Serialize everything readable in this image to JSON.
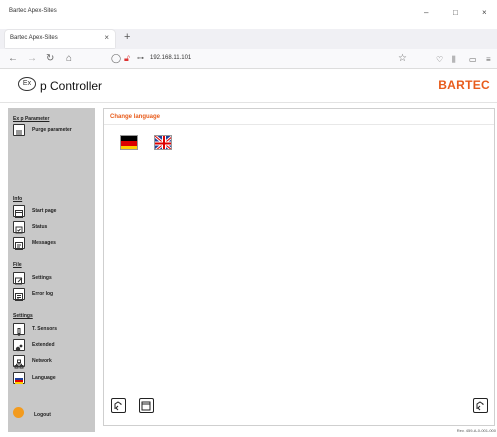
{
  "window": {
    "title": "Bartec Apex-Sites",
    "minimize": "–",
    "maximize": "□",
    "close": "×"
  },
  "tab": {
    "label": "Bartec Apex-Sites",
    "close": "×",
    "new_tab": "+"
  },
  "navbar": {
    "url": "192.168.11.101"
  },
  "header": {
    "logo_text": "Ex",
    "app_name": "p Controller",
    "brand": "BARTEC"
  },
  "sidebar": {
    "sections": [
      {
        "title": "Ex p Parameter",
        "items": [
          {
            "label": "Purge parameter",
            "icon": "purge-icon"
          }
        ]
      },
      {
        "title": "Info",
        "items": [
          {
            "label": "Start page",
            "icon": "start-page-icon"
          },
          {
            "label": "Status",
            "icon": "status-icon"
          },
          {
            "label": "Messages",
            "icon": "messages-icon"
          }
        ]
      },
      {
        "title": "File",
        "items": [
          {
            "label": "Settings",
            "icon": "settings-icon"
          },
          {
            "label": "Error log",
            "icon": "error-log-icon"
          }
        ]
      },
      {
        "title": "Settings",
        "items": [
          {
            "label": "T. Sensors",
            "icon": "sensor-icon"
          },
          {
            "label": "Extended",
            "icon": "extended-icon"
          },
          {
            "label": "Network",
            "icon": "network-icon"
          },
          {
            "label": "Language",
            "icon": "language-icon"
          }
        ]
      }
    ],
    "logout": "Logout"
  },
  "main": {
    "title": "Change language",
    "languages": [
      {
        "code": "de",
        "icon": "german-flag-icon"
      },
      {
        "code": "en",
        "icon": "uk-flag-icon"
      }
    ]
  },
  "footer": {
    "version": "Rev. 459-A-0-001-000"
  },
  "colors": {
    "accent": "#e85c1c",
    "sidebar_bg": "#c8c8c8",
    "logout": "#f39b1e"
  }
}
